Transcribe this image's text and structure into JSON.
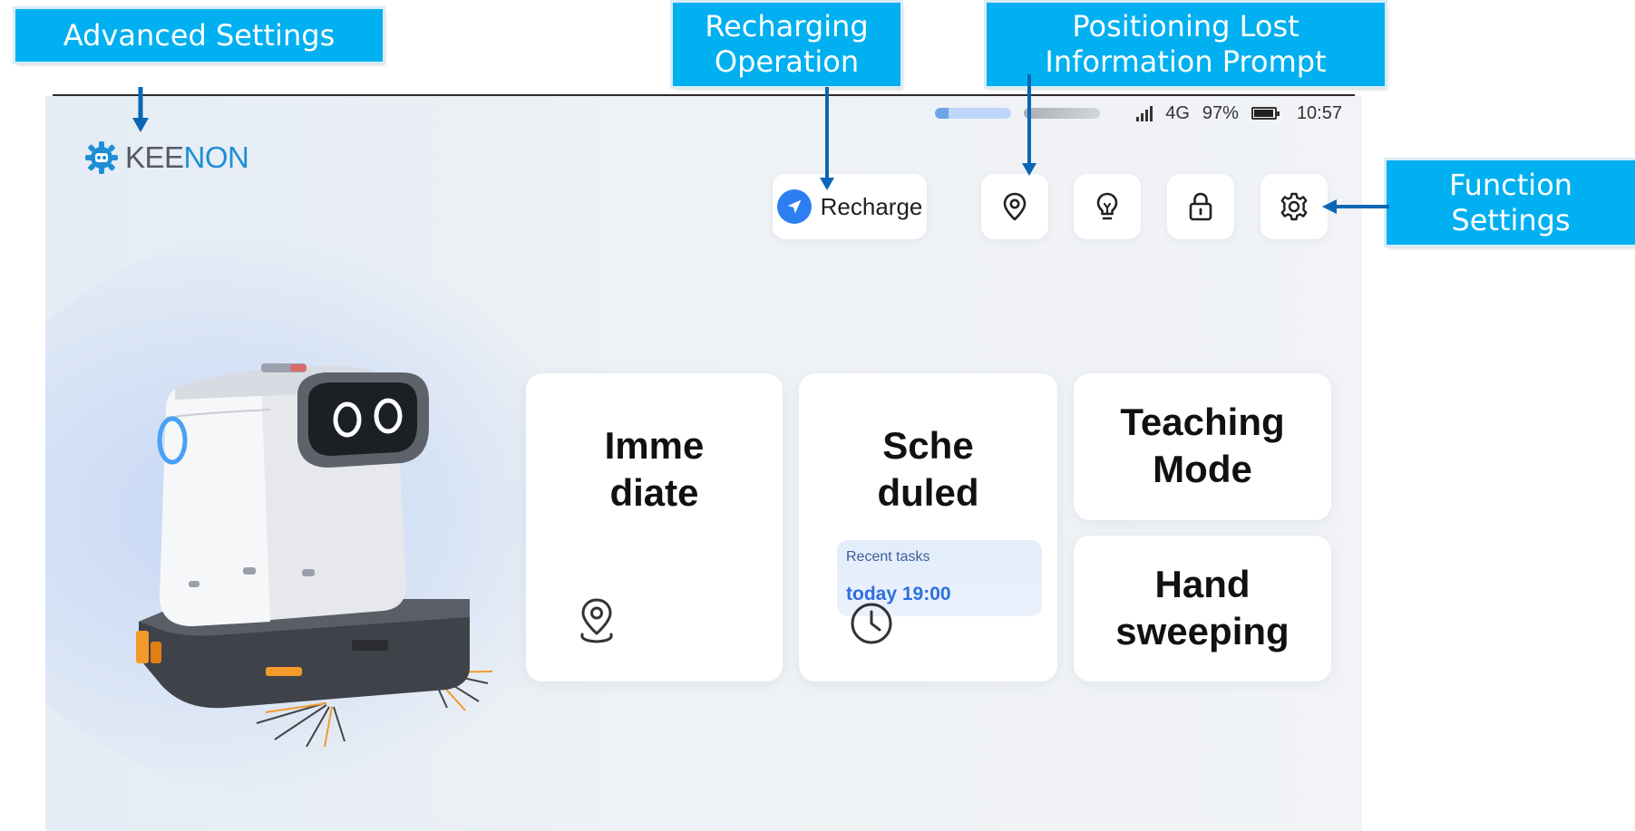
{
  "callouts": {
    "advanced_settings": "Advanced Settings",
    "recharging_operation": [
      "Recharging",
      "Operation"
    ],
    "positioning_lost": [
      "Positioning Lost",
      "Information Prompt"
    ],
    "function_settings": [
      "Function",
      "Settings"
    ]
  },
  "status_bar": {
    "network": "4G",
    "battery": "97%",
    "time": "10:57"
  },
  "logo": {
    "part1": "KEE",
    "part2": "NON",
    "brand_color": "#1e8fd6"
  },
  "toolbar": {
    "recharge_label": "Recharge",
    "icons": [
      "navigation-icon",
      "location-pin-icon",
      "lightbulb-icon",
      "lock-icon",
      "gear-icon"
    ]
  },
  "modes": {
    "immediate": [
      "Imme",
      "diate"
    ],
    "scheduled": [
      "Sche",
      "duled"
    ],
    "teaching": [
      "Teaching",
      "Mode"
    ],
    "hand_sweeping": [
      "Hand",
      "sweeping"
    ]
  },
  "recent_tasks": {
    "label": "Recent tasks",
    "time": "today 19:00"
  },
  "colors": {
    "callout_bg": "#00b0f0",
    "accent_blue": "#2d7ff1"
  }
}
